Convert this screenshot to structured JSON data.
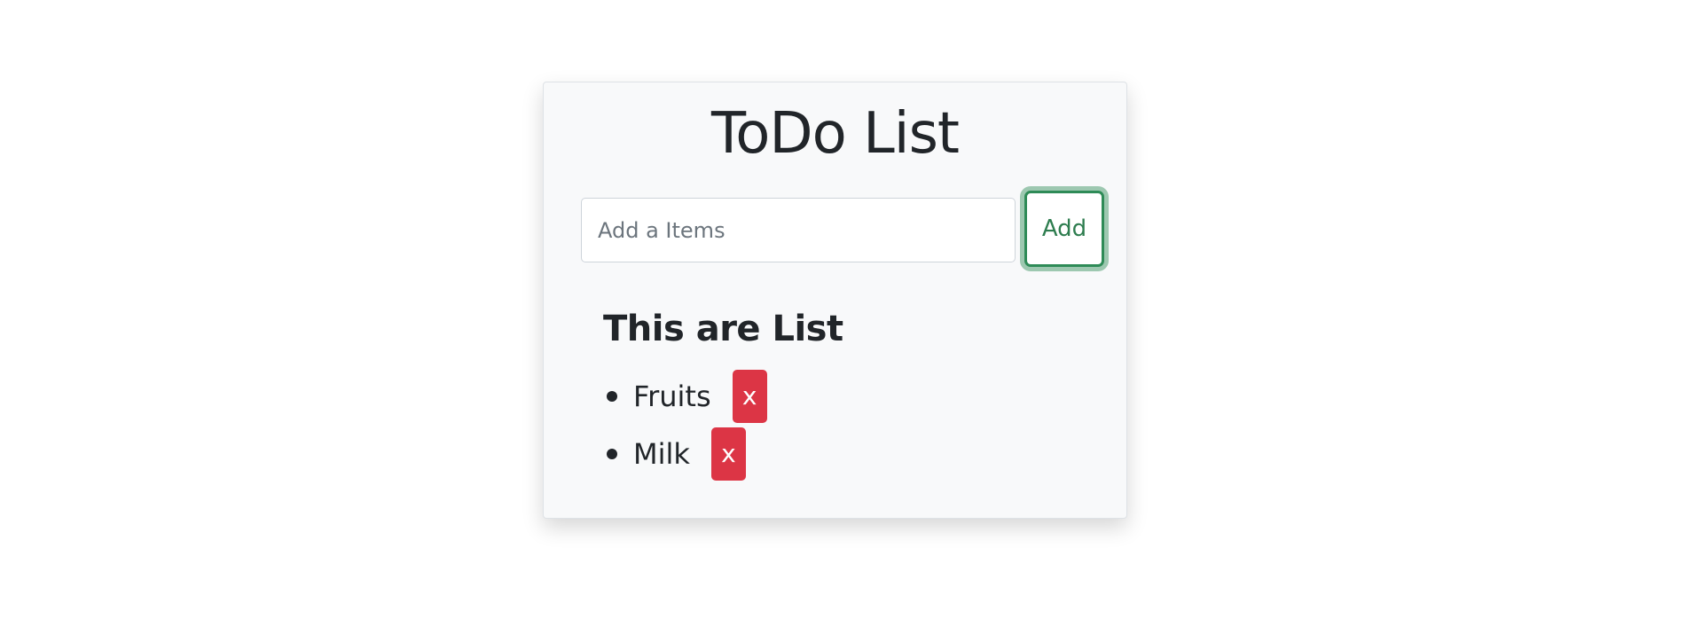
{
  "app": {
    "title": "ToDo List"
  },
  "form": {
    "input_value": "",
    "input_placeholder": "Add a Items",
    "add_label": "Add"
  },
  "list": {
    "heading": "This are List",
    "items": [
      {
        "label": "Fruits",
        "delete_label": "x"
      },
      {
        "label": "Milk",
        "delete_label": "x"
      }
    ]
  },
  "colors": {
    "card_background": "#f8f9fa",
    "add_button_accent": "#2e8b57",
    "delete_button": "#dc3545",
    "text": "#212529"
  }
}
